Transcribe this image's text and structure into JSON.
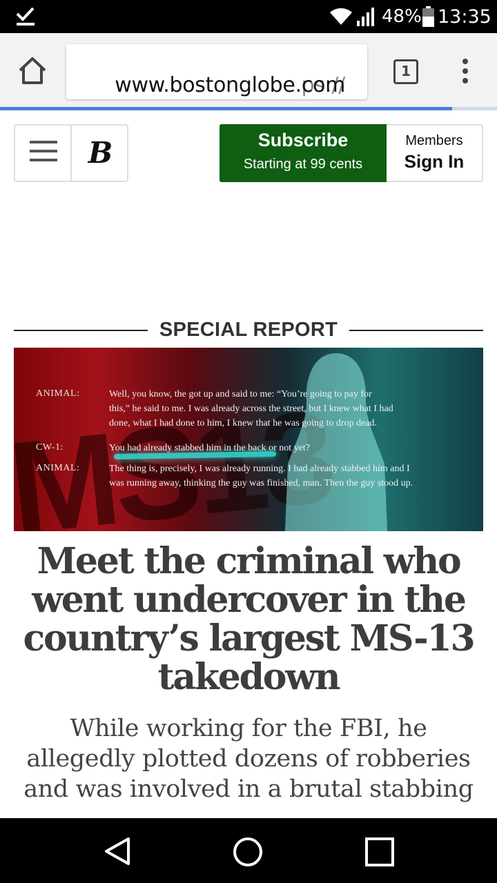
{
  "status_bar": {
    "battery_percent": "48%",
    "time": "13:35",
    "icons": [
      "download-done-icon",
      "wifi-icon",
      "signal-icon",
      "battery-icon"
    ]
  },
  "browser": {
    "url_scheme": "ps://",
    "url_host": "www.bostonglobe.com",
    "tab_count": "1",
    "load_progress": 0.91
  },
  "header": {
    "logo_letter": "B",
    "subscribe_title": "Subscribe",
    "subscribe_subtitle": "Starting at 99 cents",
    "members_label": "Members",
    "signin_label": "Sign In",
    "subscribe_color": "#0f5e12"
  },
  "section": {
    "label": "SPECIAL REPORT"
  },
  "hero": {
    "background_letters": "MS13",
    "transcript": [
      {
        "speaker": "ANIMAL:",
        "lines": [
          "Well, you know, the      got up and said to me: “You’re going to pay for",
          "this,” he said to me. I was already across the street, but I knew what I had",
          "done, what I had done to him, I knew that he was going to drop dead."
        ]
      },
      {
        "speaker": "CW-1:",
        "lines": [
          "You had already stabbed him in the back or not yet?"
        ]
      },
      {
        "speaker": "ANIMAL:",
        "lines": [
          "The thing is, precisely, I was already running. I had already stabbed him and I",
          "was running away, thinking the guy was finished, man. Then the guy stood up."
        ]
      }
    ]
  },
  "article": {
    "headline": "Meet the criminal who went undercover in the country’s largest MS-13 takedown",
    "dek": "While working for the FBI, he allegedly plotted dozens of robberies and was involved in a brutal stabbing"
  }
}
